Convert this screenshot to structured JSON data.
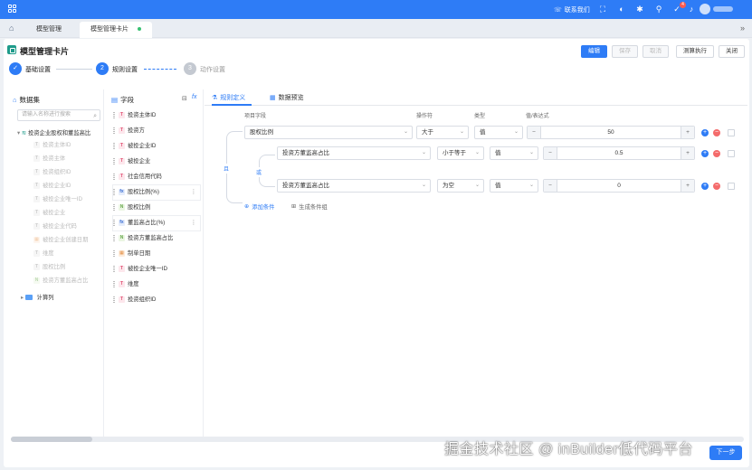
{
  "topbar": {
    "contact_label": "联系我们",
    "notification_count": "4"
  },
  "tabs": [
    {
      "label": "模型管理"
    },
    {
      "label": "模型管理卡片"
    }
  ],
  "page": {
    "title": "模型管理卡片",
    "buttons": {
      "edit": "编辑",
      "save": "保存",
      "cancel": "取消",
      "test_run": "测算执行",
      "close": "关闭"
    }
  },
  "steps": [
    {
      "number": "1",
      "label": "基础设置",
      "status": "done"
    },
    {
      "number": "2",
      "label": "规则设置",
      "status": "active"
    },
    {
      "number": "3",
      "label": "动作设置",
      "status": "todo"
    }
  ],
  "dataset": {
    "title": "数据集",
    "search_placeholder": "请输入名称进行搜索",
    "root": "投资企业股权和董监高比",
    "items": [
      {
        "label": "投资主体ID",
        "type": "T"
      },
      {
        "label": "投资主体",
        "type": "T"
      },
      {
        "label": "投资组织ID",
        "type": "T"
      },
      {
        "label": "被投企业ID",
        "type": "T"
      },
      {
        "label": "被投企业唯一ID",
        "type": "T"
      },
      {
        "label": "被投企业",
        "type": "T"
      },
      {
        "label": "被投企业代码",
        "type": "T"
      },
      {
        "label": "被投企业创建日期",
        "type": "D"
      },
      {
        "label": "维度",
        "type": "T"
      },
      {
        "label": "股权比例",
        "type": "T"
      },
      {
        "label": "投资方董监高占比",
        "type": "N"
      }
    ],
    "calc_folder": "计算列"
  },
  "fields": {
    "title": "字段",
    "items": [
      {
        "label": "投资主体ID",
        "type": "T"
      },
      {
        "label": "投资方",
        "type": "T"
      },
      {
        "label": "被投企业ID",
        "type": "T"
      },
      {
        "label": "被投企业",
        "type": "T"
      },
      {
        "label": "社会信用代码",
        "type": "T"
      },
      {
        "label": "股权比例(%)",
        "type": "fx"
      },
      {
        "label": "股权比例",
        "type": "N"
      },
      {
        "label": "董监高占比(%)",
        "type": "fx"
      },
      {
        "label": "投资方董监高占比",
        "type": "N"
      },
      {
        "label": "制单日期",
        "type": "D"
      },
      {
        "label": "被投企业唯一ID",
        "type": "T"
      },
      {
        "label": "维度",
        "type": "T"
      },
      {
        "label": "投资组织ID",
        "type": "T"
      }
    ]
  },
  "rule": {
    "tabs": {
      "definition": "规则定义",
      "preview": "数据预览"
    },
    "headers": {
      "field": "项目字段",
      "operator": "操作符",
      "type": "类型",
      "value": "值/表达式"
    },
    "logic_and": "且",
    "logic_or": "或",
    "conditions": [
      {
        "field": "股权比例",
        "operator": "大于",
        "type": "值",
        "value": "50"
      },
      {
        "field": "投资方董监高占比",
        "operator": "小于等于",
        "type": "值",
        "value": "0.5"
      },
      {
        "field": "投资方董监高占比",
        "operator": "为空",
        "type": "值",
        "value": "0"
      }
    ],
    "add_condition": "添加条件",
    "gen_group": "生成条件组"
  },
  "watermark": "掘金技术社区 @ inBuilder低代码平台",
  "float_button": "下一步"
}
